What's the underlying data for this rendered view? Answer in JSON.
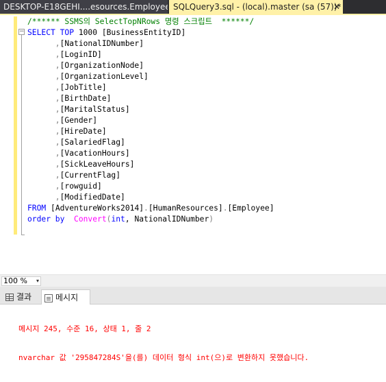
{
  "tabs": {
    "inactive_label": "DESKTOP-E18GEHI....esources.Employee",
    "active_label": "SQLQuery3.sql - (local).master (sa (57))*",
    "close_glyph": "✕"
  },
  "editor": {
    "lines": [
      [
        {
          "t": "/****** SSMS의 SelectTopNRows 명령 스크립트  ******/",
          "c": "cm"
        }
      ],
      [
        {
          "t": "SELECT TOP ",
          "c": "kw"
        },
        {
          "t": "1000 [BusinessEntityID]",
          "c": ""
        }
      ],
      [
        {
          "t": "      ,",
          "c": "gy"
        },
        {
          "t": "[NationalIDNumber]",
          "c": ""
        }
      ],
      [
        {
          "t": "      ,",
          "c": "gy"
        },
        {
          "t": "[LoginID]",
          "c": ""
        }
      ],
      [
        {
          "t": "      ,",
          "c": "gy"
        },
        {
          "t": "[OrganizationNode]",
          "c": ""
        }
      ],
      [
        {
          "t": "      ,",
          "c": "gy"
        },
        {
          "t": "[OrganizationLevel]",
          "c": ""
        }
      ],
      [
        {
          "t": "      ,",
          "c": "gy"
        },
        {
          "t": "[JobTitle]",
          "c": ""
        }
      ],
      [
        {
          "t": "      ,",
          "c": "gy"
        },
        {
          "t": "[BirthDate]",
          "c": ""
        }
      ],
      [
        {
          "t": "      ,",
          "c": "gy"
        },
        {
          "t": "[MaritalStatus]",
          "c": ""
        }
      ],
      [
        {
          "t": "      ,",
          "c": "gy"
        },
        {
          "t": "[Gender]",
          "c": ""
        }
      ],
      [
        {
          "t": "      ,",
          "c": "gy"
        },
        {
          "t": "[HireDate]",
          "c": ""
        }
      ],
      [
        {
          "t": "      ,",
          "c": "gy"
        },
        {
          "t": "[SalariedFlag]",
          "c": ""
        }
      ],
      [
        {
          "t": "      ,",
          "c": "gy"
        },
        {
          "t": "[VacationHours]",
          "c": ""
        }
      ],
      [
        {
          "t": "      ,",
          "c": "gy"
        },
        {
          "t": "[SickLeaveHours]",
          "c": ""
        }
      ],
      [
        {
          "t": "      ,",
          "c": "gy"
        },
        {
          "t": "[CurrentFlag]",
          "c": ""
        }
      ],
      [
        {
          "t": "      ,",
          "c": "gy"
        },
        {
          "t": "[rowguid]",
          "c": ""
        }
      ],
      [
        {
          "t": "      ,",
          "c": "gy"
        },
        {
          "t": "[ModifiedDate]",
          "c": ""
        }
      ],
      [
        {
          "t": "FROM ",
          "c": "kw"
        },
        {
          "t": "[AdventureWorks2014]",
          "c": ""
        },
        {
          "t": ".",
          "c": "gy"
        },
        {
          "t": "[HumanResources]",
          "c": ""
        },
        {
          "t": ".",
          "c": "gy"
        },
        {
          "t": "[Employee]",
          "c": ""
        }
      ],
      [
        {
          "t": "order by  ",
          "c": "kw"
        },
        {
          "t": "Convert",
          "c": "fn"
        },
        {
          "t": "(",
          "c": "gy"
        },
        {
          "t": "int",
          "c": "kw"
        },
        {
          "t": ", NationalIDNumber",
          "c": ""
        },
        {
          "t": ")",
          "c": "gy"
        }
      ]
    ],
    "collapse_glyph": "−"
  },
  "zoom": {
    "value": "100 %",
    "arrow": "▾"
  },
  "results_tabs": {
    "results_label": "결과",
    "messages_label": "메시지"
  },
  "messages": {
    "lines": [
      "메시지 245, 수준 16, 상태 1, 줄 2",
      "nvarchar 값 '295847284S'을(를) 데이터 형식 int(으)로 변환하지 못했습니다."
    ]
  },
  "colors": {
    "comment": "#008000",
    "keyword": "#0000ff",
    "operator": "#808080",
    "function": "#ff00ff",
    "error": "#ff0000",
    "active_tab": "#fff1a8"
  }
}
